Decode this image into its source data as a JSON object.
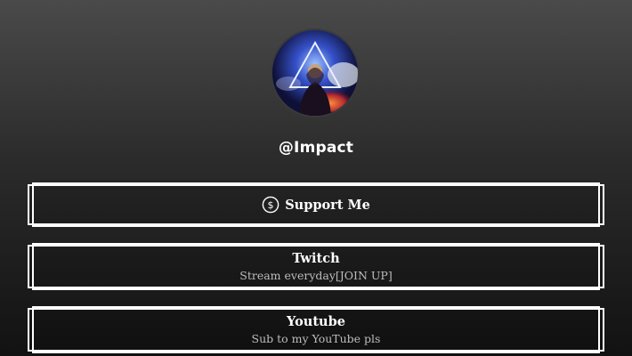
{
  "profile": {
    "handle": "@Impact",
    "avatar_icon": "hooded-figure-triangle-avatar"
  },
  "links": [
    {
      "title": "Support Me",
      "subtitle": "",
      "icon": "dollar-circle-icon"
    },
    {
      "title": "Twitch",
      "subtitle": "Stream everyday[JOIN UP]",
      "icon": ""
    },
    {
      "title": "Youtube",
      "subtitle": "Sub to my YouTube pls",
      "icon": ""
    }
  ],
  "colors": {
    "background_top": "#4a4a4a",
    "background_bottom": "#121212",
    "button_border": "#ffffff",
    "text": "#ffffff",
    "subtitle": "#bdbdbd"
  }
}
